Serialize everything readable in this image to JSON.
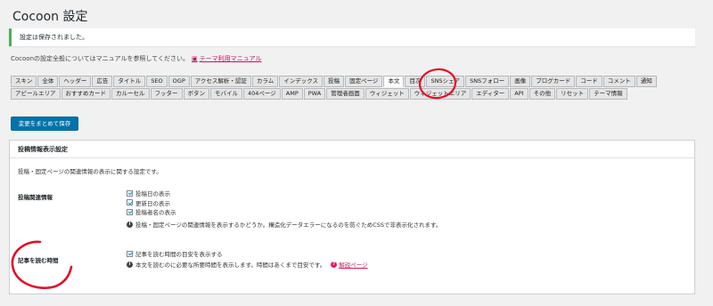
{
  "page": {
    "title": "Cocoon 設定"
  },
  "notice": {
    "text": "設定は保存されました。"
  },
  "manual": {
    "text": "Cocoonの設定全般についてはマニュアルを参照してください。",
    "link_label": "テーマ利用マニュアル",
    "link_icon": "book-icon"
  },
  "tabs": [
    {
      "label": "スキン"
    },
    {
      "label": "全体"
    },
    {
      "label": "ヘッダー"
    },
    {
      "label": "広告"
    },
    {
      "label": "タイトル"
    },
    {
      "label": "SEO"
    },
    {
      "label": "OGP"
    },
    {
      "label": "アクセス解析・認証"
    },
    {
      "label": "カラム"
    },
    {
      "label": "インデックス"
    },
    {
      "label": "投稿"
    },
    {
      "label": "固定ページ"
    },
    {
      "label": "本文"
    },
    {
      "label": "目次"
    },
    {
      "label": "SNSシェア"
    },
    {
      "label": "SNSフォロー"
    },
    {
      "label": "画像"
    },
    {
      "label": "ブログカード"
    },
    {
      "label": "コード"
    },
    {
      "label": "コメント"
    },
    {
      "label": "通知"
    },
    {
      "label": "アピールエリア"
    },
    {
      "label": "おすすめカード"
    },
    {
      "label": "カルーセル"
    },
    {
      "label": "フッター"
    },
    {
      "label": "ボタン"
    },
    {
      "label": "モバイル"
    },
    {
      "label": "404ページ"
    },
    {
      "label": "AMP"
    },
    {
      "label": "PWA"
    },
    {
      "label": "管理者画面"
    },
    {
      "label": "ウィジェット"
    },
    {
      "label": "ウィジェットエリア"
    },
    {
      "label": "エディター"
    },
    {
      "label": "API"
    },
    {
      "label": "その他"
    },
    {
      "label": "リセット"
    },
    {
      "label": "テーマ情報"
    }
  ],
  "active_tab": "本文",
  "save_button": {
    "label": "変更をまとめて保存"
  },
  "panel": {
    "heading": "投稿情報表示設定",
    "description": "投稿・固定ページの関連情報の表示に関する設定です。",
    "post_meta": {
      "label": "投稿関連情報",
      "checks": [
        {
          "label": "投稿日の表示",
          "checked": true
        },
        {
          "label": "更新日の表示",
          "checked": true
        },
        {
          "label": "投稿者名の表示",
          "checked": true
        }
      ],
      "info": "投稿・固定ページの関連情報を表示するかどうか。構造化データエラーになるのを防ぐためCSSで非表示化されます。"
    },
    "reading_time": {
      "label": "記事を読む時間",
      "checks": [
        {
          "label": "記事を読む時間の目安を表示する",
          "checked": true
        }
      ],
      "info": "本文を読むのに必要な所要時間を表示します。時間はあくまで目安です。",
      "help_link": "解説ページ"
    }
  },
  "colors": {
    "accent": "#0073aa",
    "notice_border": "#46b450",
    "link": "#c2185b",
    "annotation": "#e0102a"
  }
}
